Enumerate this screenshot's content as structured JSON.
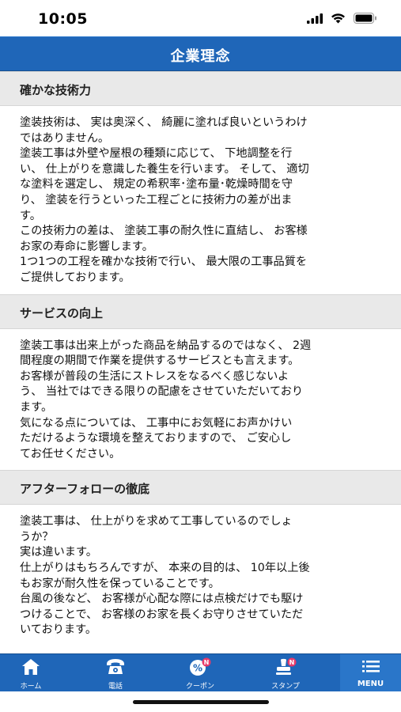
{
  "status": {
    "time": "10:05"
  },
  "header": {
    "title": "企業理念"
  },
  "sections": [
    {
      "title": "確かな技術力",
      "lines": [
        "塗装技術は、 実は奥深く、 綺麗に塗れば良いというわけ",
        "ではありません。",
        "塗装工事は外壁や屋根の種類に応じて、 下地調整を行",
        "い、 仕上がりを意識した養生を行います。 そして、 適切",
        "な塗料を選定し、 規定の希釈率･塗布量･乾燥時間を守",
        "り、 塗装を行うといった工程ごとに技術力の差が出ま",
        "す。",
        "この技術力の差は、 塗装工事の耐久性に直結し、 お客様",
        "お家の寿命に影響します。",
        "1つ1つの工程を確かな技術で行い、 最大限の工事品質を",
        "ご提供しております。"
      ]
    },
    {
      "title": "サービスの向上",
      "lines": [
        "塗装工事は出来上がった商品を納品するのではなく、 2週",
        "間程度の期間で作業を提供するサービスとも言えます。",
        "お客様が普段の生活にストレスをなるべく感じないよ",
        "う、 当社ではできる限りの配慮をさせていただいており",
        "ます。",
        "気になる点については、 工事中にお気軽にお声かけい",
        "ただけるような環境を整えておりますので、 ご安心し",
        "てお任せください。"
      ]
    },
    {
      "title": "アフターフォローの徹底",
      "lines": [
        "塗装工事は、 仕上がりを求めて工事しているのでしょ",
        "うか？",
        "実は違います。",
        "仕上がりはもちろんですが、 本来の目的は、 10年以上後",
        "もお家が耐久性を保っていることです。",
        "台風の後など、 お客様が心配な際には点検だけでも駆け",
        "つけることで、 お客様のお家を長くお守りさせていただ",
        "いております。"
      ]
    }
  ],
  "tabbar": {
    "items": [
      {
        "label": "ホーム",
        "icon": "home-icon"
      },
      {
        "label": "電話",
        "icon": "phone-icon"
      },
      {
        "label": "クーポン",
        "icon": "coupon-icon",
        "badge": "N"
      },
      {
        "label": "スタンプ",
        "icon": "stamp-icon",
        "badge": "N"
      },
      {
        "label": "MENU",
        "icon": "menu-icon"
      }
    ]
  },
  "colors": {
    "primary": "#1f66b8",
    "section_bg": "#e9e9e9",
    "badge": "#e83a6a"
  }
}
